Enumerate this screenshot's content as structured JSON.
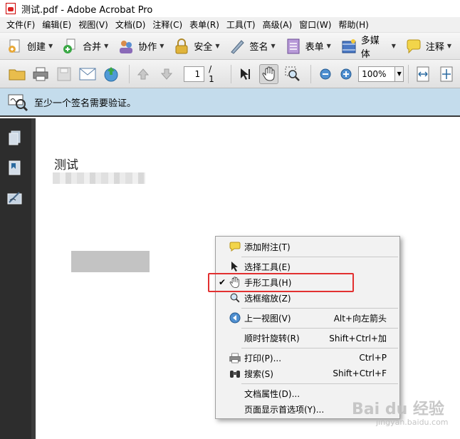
{
  "window": {
    "title": "测试.pdf - Adobe Acrobat Pro"
  },
  "menubar": {
    "items": [
      "文件(F)",
      "编辑(E)",
      "视图(V)",
      "文档(D)",
      "注释(C)",
      "表单(R)",
      "工具(T)",
      "高级(A)",
      "窗口(W)",
      "帮助(H)"
    ]
  },
  "toolbar1": {
    "create": "创建",
    "combine": "合并",
    "collaborate": "协作",
    "secure": "安全",
    "sign": "签名",
    "forms": "表单",
    "multimedia": "多媒体",
    "comment": "注释"
  },
  "toolbar2": {
    "page_number": "1",
    "page_total": "/ 1",
    "zoom": "100%"
  },
  "notification": {
    "text": "至少一个签名需要验证。"
  },
  "document": {
    "title": "测试"
  },
  "context_menu": {
    "add_note": "添加附注(T)",
    "select_tool": "选择工具(E)",
    "hand_tool": "手形工具(H)",
    "marquee_zoom": "选框缩放(Z)",
    "previous_view": "上一视图(V)",
    "previous_view_shortcut": "Alt+向左箭头",
    "rotate_clockwise": "顺时针旋转(R)",
    "rotate_shortcut": "Shift+Ctrl+加",
    "print": "打印(P)...",
    "print_shortcut": "Ctrl+P",
    "search": "搜索(S)",
    "search_shortcut": "Shift+Ctrl+F",
    "doc_properties": "文档属性(D)...",
    "page_display_prefs": "页面显示首选项(Y)...",
    "checked_item_mark": "✔"
  },
  "watermark": {
    "brand": "Bai du 经验",
    "url": "jingyan.baidu.com"
  },
  "colors": {
    "notify_bg": "#c4dcec",
    "highlight_box": "#e23030",
    "left_panel": "#2d2d2d"
  }
}
